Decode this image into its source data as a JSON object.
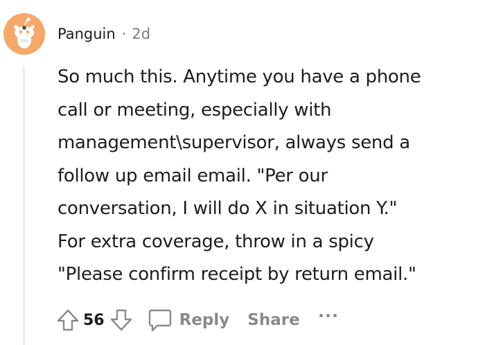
{
  "comment": {
    "author": "Panguin",
    "separator": "·",
    "age": "2d",
    "body_lines": [
      "So much this. Anytime you have a phone",
      "call or meeting, especially with",
      "management\\supervisor, always send a",
      "follow up email email. \"Per our",
      "conversation, I will do X in situation Y.\"",
      "For extra coverage, throw in a spicy",
      "\"Please confirm receipt by return email.\""
    ],
    "avatar_icon": "snoo-avatar-icon",
    "avatar_color": "#f5a86a"
  },
  "actions": {
    "score": "56",
    "upvote_icon": "arrow-up-icon",
    "downvote_icon": "arrow-down-icon",
    "reply_icon": "speech-bubble-icon",
    "reply_label": "Reply",
    "share_label": "Share",
    "more_icon": "ellipsis-icon",
    "muted_color": "#878a8c"
  }
}
